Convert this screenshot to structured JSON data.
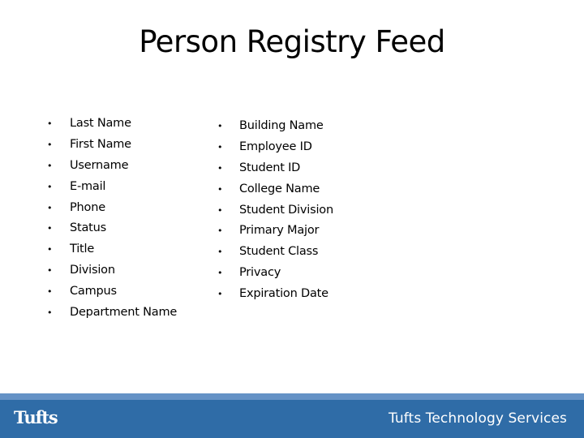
{
  "slide": {
    "title": "Person Registry Feed",
    "bullet_glyph": "•",
    "left_column": {
      "items": [
        {
          "label": "Last Name"
        },
        {
          "label": "First Name"
        },
        {
          "label": "Username"
        },
        {
          "label": "E-mail"
        },
        {
          "label": "Phone"
        },
        {
          "label": "Status"
        },
        {
          "label": "Title"
        },
        {
          "label": "Division"
        },
        {
          "label": "Campus"
        },
        {
          "label": "Department Name"
        }
      ]
    },
    "right_column": {
      "items": [
        {
          "label": "Building Name"
        },
        {
          "label": "Employee ID"
        },
        {
          "label": "Student ID"
        },
        {
          "label": "College Name"
        },
        {
          "label": "Student Division"
        },
        {
          "label": "Primary Major"
        },
        {
          "label": "Student Class"
        },
        {
          "label": "Privacy"
        },
        {
          "label": "Expiration Date"
        }
      ]
    }
  },
  "footer": {
    "logo_text": "Tufts",
    "department": "Tufts Technology Services",
    "colors": {
      "band": "#2f6ca7",
      "strip": "#6592c6"
    }
  }
}
